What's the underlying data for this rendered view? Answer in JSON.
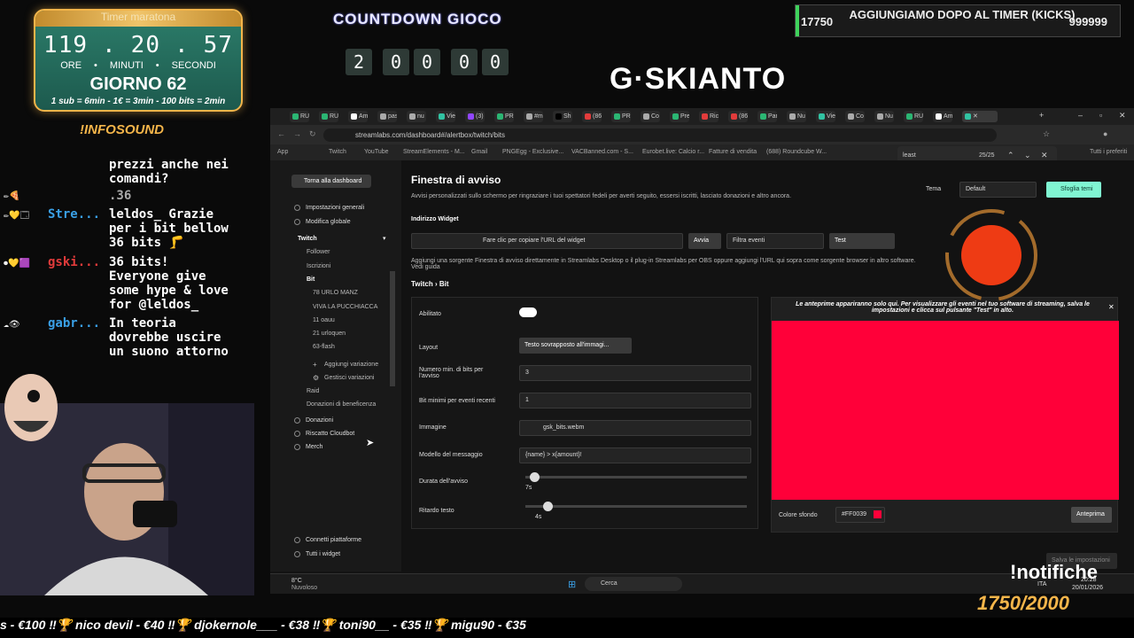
{
  "timer": {
    "title": "Timer maratona",
    "hours": "119",
    "minutes": "20",
    "seconds": "57",
    "hours_label": "ORE",
    "minutes_label": "MINUTI",
    "seconds_label": "SECONDI",
    "day": "GIORNO 62",
    "rates": "1 sub = 6min - 1€ = 3min - 100 bits = 2min"
  },
  "infosound": "!INFOSOUND",
  "countdown": {
    "title": "COUNTDOWN GIOCO",
    "digits": [
      "2",
      "0",
      "0",
      "0",
      "0"
    ]
  },
  "logo": "G·SKIANTO",
  "goal": {
    "left": "17750",
    "title": "AGGIUNGIAMO DOPO AL TIMER (KICKS)",
    "right": "999999"
  },
  "chat": [
    {
      "name": "",
      "msg": "prezzi anche nei\ncomandi?"
    },
    {
      "name": "",
      "msg": ".36"
    },
    {
      "name": "Stre...",
      "msg": "leldos_ Grazie\nper i bit bellow\n36 bits 🦵"
    },
    {
      "name": "gski...",
      "msg": "36 bits!\nEveryone give\nsome hype & love\nfor @leldos_"
    },
    {
      "name": "gabr...",
      "msg": "In teoria\ndovrebbe uscire\nun suono attorno"
    }
  ],
  "browser": {
    "url": "streamlabs.com/dashboard#/alertbox/twitch/bits",
    "find_query": "least",
    "find_count": "25/25",
    "tabs": [
      "RUG",
      "RUG",
      "Am",
      "pas",
      "nu",
      "Vie",
      "(3)",
      "PRE",
      "#m",
      "Sh",
      "(86)",
      "PRE",
      "Co",
      "Pre",
      "Ric",
      "(86)",
      "Pan",
      "Nu",
      "Vie",
      "Co",
      "Nu",
      "RUG",
      "Am"
    ],
    "bookmarks": [
      "App",
      "Twitch",
      "YouTube",
      "StreamElements - M...",
      "Gmail",
      "PNGEgg - Exclusive...",
      "VACBanned.com - S...",
      "Eurobet.live: Calcio r...",
      "Fatture di vendita",
      "(688) Roundcube W...",
      "Tutti i preferiti"
    ]
  },
  "sidebar": {
    "back": "Torna alla dashboard",
    "items": [
      {
        "label": "Impostazioni generali"
      },
      {
        "label": "Modifica globale"
      },
      {
        "label": "Twitch"
      },
      {
        "label": "Follower"
      },
      {
        "label": "Iscrizioni"
      },
      {
        "label": "Bit"
      },
      {
        "label": "78 URLO MANZ"
      },
      {
        "label": "VIVA LA PUCCHIACCA"
      },
      {
        "label": "11 oauu"
      },
      {
        "label": "21 urloquen"
      },
      {
        "label": "63-flash"
      },
      {
        "label": "Aggiungi variazione"
      },
      {
        "label": "Gestisci variazioni"
      },
      {
        "label": "Raid"
      },
      {
        "label": "Donazioni di beneficenza"
      },
      {
        "label": "Donazioni"
      },
      {
        "label": "Riscatto Cloudbot"
      },
      {
        "label": "Merch"
      },
      {
        "label": "Connetti piattaforme"
      },
      {
        "label": "Tutti i widget"
      }
    ]
  },
  "main": {
    "title": "Finestra di avviso",
    "subtitle": "Avvisi personalizzati sullo schermo per ringraziare i tuoi spettatori fedeli per averti seguito, essersi iscritti, lasciato donazioni e altro ancora.",
    "theme_label": "Tema",
    "theme_value": "Default",
    "browse_themes": "Sfoglia temi",
    "widget_address": "Indirizzo Widget",
    "copy_url": "Fare clic per copiare l'URL del widget",
    "launch": "Avvia",
    "filter": "Filtra eventi",
    "test": "Test",
    "info": "Aggiungi una sorgente Finestra di avviso direttamente in Streamlabs Desktop o il plug-in Streamlabs per OBS oppure aggiungi l'URL qui sopra come sorgente browser in altro software. Vedi guida",
    "section": "Twitch › Bit",
    "enabled_label": "Abilitato",
    "layout_label": "Layout",
    "layout_value": "Testo sovrapposto all'immagi...",
    "min_bits_label": "Numero min. di bits per l'avviso",
    "min_bits_value": "3",
    "min_recent_label": "Bit minimi per eventi recenti",
    "min_recent_value": "1",
    "image_label": "Immagine",
    "image_value": "gsk_bits.webm",
    "template_label": "Modello del messaggio",
    "template_value": "{name} > x{amount}!",
    "duration_label": "Durata dell'avviso",
    "duration_value": "7s",
    "duration_level": 0.02,
    "delay_label": "Ritardo testo",
    "delay_value": "4s",
    "delay_level": 0.08,
    "preview_note": "Le anteprime appariranno solo qui. Per visualizzare gli eventi nel tuo software di streaming, salva le impostazioni e clicca sul pulsante \"Test\" in alto.",
    "bg_label": "Colore sfondo",
    "bg_value": "#FF0039",
    "preview_button": "Anteprima",
    "save": "Salva le impostazioni"
  },
  "taskbar": {
    "weather_temp": "8°C",
    "weather": "Nuvoloso",
    "search": "Cerca",
    "lang": "ITA",
    "time": "20:28",
    "date": "20/01/2026"
  },
  "notifiche": "!notifiche",
  "notif_count": "1750/2000",
  "ticker": "s - €100   ‼🏆 nico devil - €40   ‼🏆 djokernole___ - €38   ‼🏆 toni90__ - €35   ‼🏆 migu90 - €35",
  "colors": {
    "accent": "#31c3a2",
    "preview_bg": "#FF0039",
    "timer_gold": "#f4b54a"
  }
}
